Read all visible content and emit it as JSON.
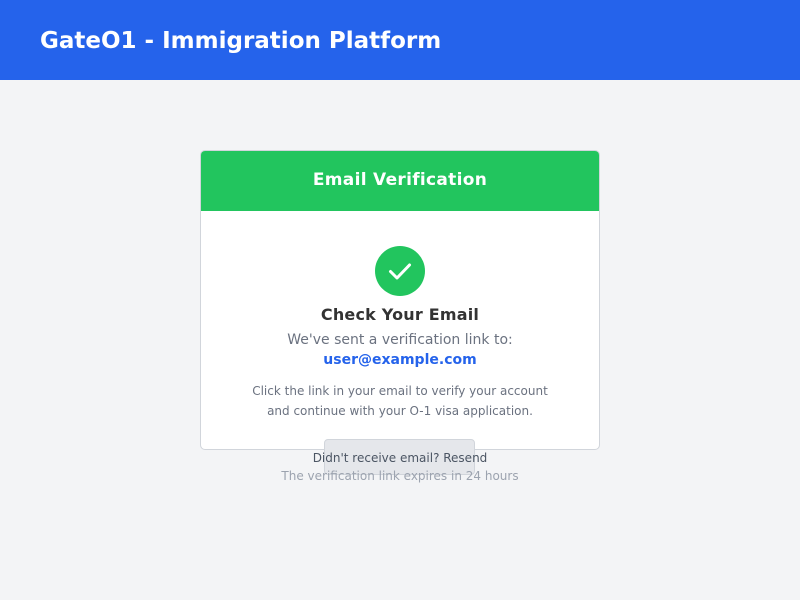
{
  "header": {
    "app_title": "GateO1 - Immigration Platform"
  },
  "card": {
    "title": "Email Verification",
    "icon": "check-circle-icon",
    "heading": "Check Your Email",
    "sent_text": "We've sent a verification link to:",
    "email": "user@example.com",
    "instruction_line1": "Click the link in your email to verify your account",
    "instruction_line2": "and continue with your O-1 visa application."
  },
  "footer": {
    "resend_label": "Didn't receive email? Resend",
    "expiry_note": "The verification link expires in 24 hours"
  },
  "colors": {
    "header_bg": "#2563eb",
    "accent_green": "#22c55e",
    "link_blue": "#2563eb",
    "page_bg": "#f3f4f6"
  }
}
